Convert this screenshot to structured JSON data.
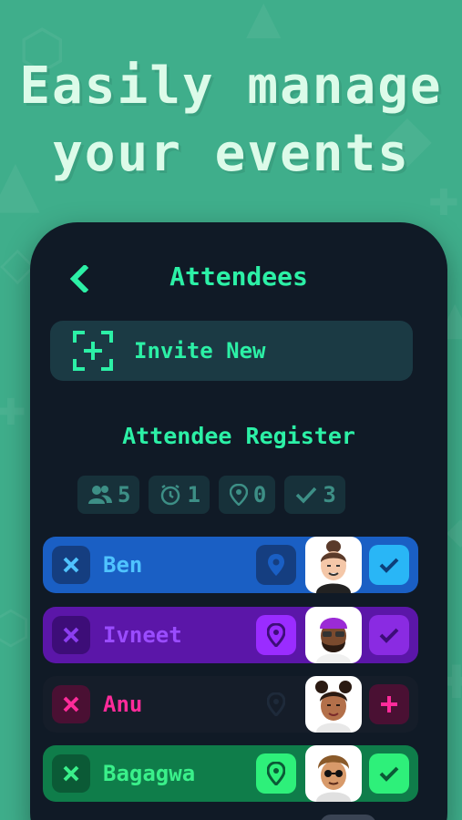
{
  "headline": {
    "line1": "Easily manage",
    "line2": "your events"
  },
  "screen": {
    "title": "Attendees"
  },
  "invite": {
    "label": "Invite New"
  },
  "register": {
    "title": "Attendee Register",
    "stats": [
      {
        "icon": "people-icon",
        "value": "5"
      },
      {
        "icon": "clock-icon",
        "value": "1"
      },
      {
        "icon": "location-pin-icon",
        "value": "0"
      },
      {
        "icon": "check-icon",
        "value": "3"
      }
    ]
  },
  "attendees": [
    {
      "name": "Ben",
      "theme": "blue",
      "checked": true
    },
    {
      "name": "Ivneet",
      "theme": "purple",
      "checked": true
    },
    {
      "name": "Anu",
      "theme": "pink",
      "checked": false
    },
    {
      "name": "Bagagwa",
      "theme": "green",
      "checked": true
    }
  ],
  "colors": {
    "background": "#3fae8b",
    "headline": "#dcfbe9",
    "phone": "#101a26",
    "accent": "#2cf0a6",
    "blue": "#1e88e5",
    "purple": "#7a22d6",
    "pink": "#ff2b9a",
    "green": "#1ed868"
  }
}
